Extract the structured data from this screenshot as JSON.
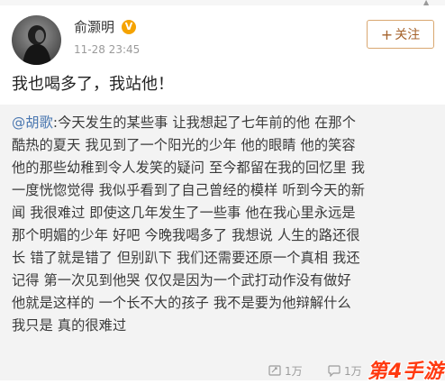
{
  "post": {
    "author_name": "俞灏明",
    "verified_badge": "V",
    "timestamp": "11-28 23:45",
    "follow_button_label": "关注",
    "follow_button_icon": "plus-icon",
    "text": "我也喝多了，我站他！"
  },
  "quoted_post": {
    "mention": "@胡歌",
    "text": ":今天发生的某些事 让我想起了七年前的他 在那个\n酷热的夏天 我见到了一个阳光的少年 他的眼睛 他的笑容\n他的那些幼稚到令人发笑的疑问 至今都留在我的回忆里 我\n一度恍惚觉得 我似乎看到了自己曾经的模样 听到今天的新\n闻 我很难过 即使这几年发生了一些事 他在我心里永远是\n那个明媚的少年 好吧 今晚我喝多了 我想说 人生的路还很\n长 错了就是错了 但别趴下 我们还需要还原一个真相 我还\n记得 第一次见到他哭 仅仅是因为一个武打动作没有做好\n他就是这样的 一个长不大的孩子 我不是要为他辩解什么\n我只是 真的很难过",
    "actions": {
      "repost_count": "1万",
      "comment_count": "1万"
    }
  },
  "watermark": "第4手游",
  "colors": {
    "follow_border": "#d9a770",
    "follow_text": "#a5622b",
    "mention": "#4a77b0",
    "quote_bg": "#f3f3f3",
    "badge": "#f5a300",
    "watermark": "#ff3a10"
  }
}
